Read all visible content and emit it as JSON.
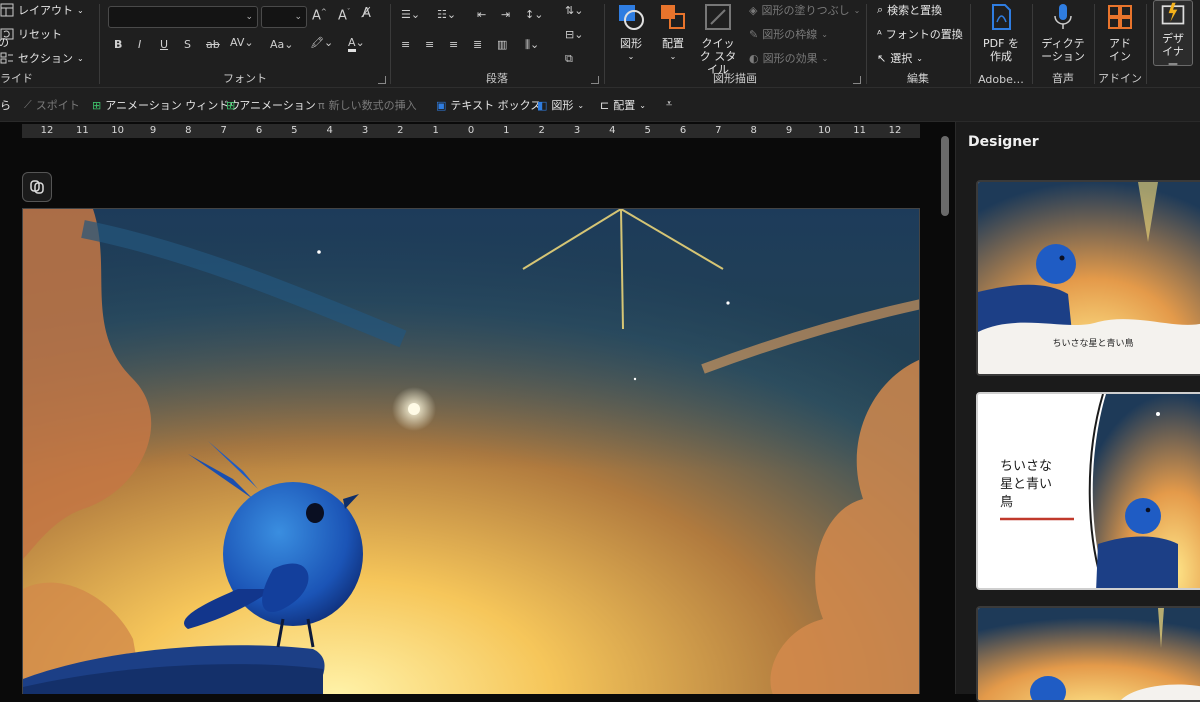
{
  "ribbon": {
    "slides_group": {
      "layout_label": "レイアウト",
      "reset_label": "リセット",
      "section_label": "セクション",
      "group_label": "ライド",
      "new_label": "の"
    },
    "font_group": {
      "group_label": "フォント",
      "font_name": "",
      "font_size": ""
    },
    "paragraph_group": {
      "group_label": "段落"
    },
    "drawing_group": {
      "group_label": "図形描画",
      "shape_label": "図形",
      "arrange_label": "配置",
      "quick_style_label": "クイック スタイル",
      "fill_label": "図形の塗りつぶし",
      "outline_label": "図形の枠線",
      "effect_label": "図形の効果"
    },
    "editing_group": {
      "group_label": "編集",
      "find_replace_label": "検索と置換",
      "font_replace_label": "フォントの置換",
      "select_label": "選択"
    },
    "adobe_group": {
      "group_label": "Adobe…",
      "pdf_label": "PDF を作成"
    },
    "voice_group": {
      "group_label": "音声",
      "dictate_label": "ディクテーション"
    },
    "addin_group": {
      "group_label": "アドイン",
      "addin_label": "アドイン"
    },
    "designer_label": "デザイナー"
  },
  "quick_toolbar": {
    "first_label": "ら",
    "eyedropper_label": "スポイト",
    "animation_window_label": "アニメーション ウィンドウ",
    "animation_label": "アニメーション",
    "equation_label": "新しい数式の挿入",
    "textbox_label": "テキスト ボックス",
    "shape_label": "図形",
    "arrange_label": "配置"
  },
  "ruler": {
    "ticks": [
      "12",
      "11",
      "10",
      "9",
      "8",
      "7",
      "6",
      "5",
      "4",
      "3",
      "2",
      "1",
      "0",
      "1",
      "2",
      "3",
      "4",
      "5",
      "6",
      "7",
      "8",
      "9",
      "10",
      "11",
      "12"
    ]
  },
  "designer": {
    "title": "Designer",
    "thumb1_caption": "ちいさな星と青い鳥",
    "thumb2_title_l1": "ちいさな",
    "thumb2_title_l2": "星と青い",
    "thumb2_title_l3": "鳥"
  },
  "colors": {
    "ribbon_bg": "#1f1f1f",
    "accent_blue": "#2f7de1",
    "accent_orange": "#e8742c",
    "caption_underline": "#c0392b",
    "selection_border": "#cfcfcf"
  }
}
